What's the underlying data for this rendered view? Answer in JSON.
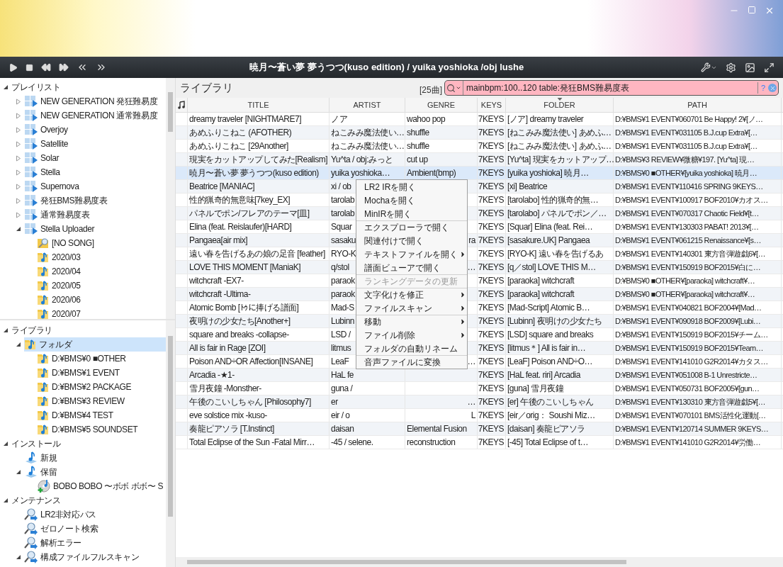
{
  "window": {
    "now_playing": "暁月〜蒼い夢 夢うつつ(kuso edition) / yuika yoshioka /obj lushe"
  },
  "sidebar": {
    "top_pane": [
      {
        "label": "プレイリスト",
        "expanded": true,
        "selected": false,
        "children": [
          {
            "label": "NEW GENERATION 発狂難易度",
            "kind": "playlist",
            "expanded": false,
            "selected": false
          },
          {
            "label": "NEW GENERATION 通常難易度",
            "kind": "playlist",
            "expanded": false,
            "selected": false
          },
          {
            "label": "Overjoy",
            "kind": "playlist",
            "expanded": false,
            "selected": false
          },
          {
            "label": "Satellite",
            "kind": "playlist",
            "expanded": false,
            "selected": false
          },
          {
            "label": "Solar",
            "kind": "playlist",
            "expanded": false,
            "selected": false
          },
          {
            "label": "Stella",
            "kind": "playlist",
            "expanded": false,
            "selected": false
          },
          {
            "label": "Supernova",
            "kind": "playlist",
            "expanded": false,
            "selected": false
          },
          {
            "label": "発狂BMS難易度表",
            "kind": "playlist",
            "expanded": false,
            "selected": false
          },
          {
            "label": "通常難易度表",
            "kind": "playlist",
            "expanded": false,
            "selected": false
          },
          {
            "label": "Stella Uploader",
            "kind": "playlist",
            "expanded": true,
            "selected": false,
            "children": [
              {
                "label": "[NO SONG]",
                "kind": "search-folder",
                "selected": false
              },
              {
                "label": "2020/03",
                "kind": "folder",
                "selected": false
              },
              {
                "label": "2020/04",
                "kind": "folder",
                "selected": false
              },
              {
                "label": "2020/05",
                "kind": "folder",
                "selected": false
              },
              {
                "label": "2020/06",
                "kind": "folder",
                "selected": false
              },
              {
                "label": "2020/07",
                "kind": "folder",
                "selected": false
              }
            ]
          }
        ]
      }
    ],
    "bottom_pane": [
      {
        "label": "ライブラリ",
        "expanded": true,
        "selected": false,
        "children": [
          {
            "label": "フォルダ",
            "kind": "folder",
            "expanded": true,
            "selected": true,
            "children": [
              {
                "label": "D:¥BMS¥0 ■OTHER",
                "kind": "folder",
                "selected": false
              },
              {
                "label": "D:¥BMS¥1 EVENT",
                "kind": "folder",
                "selected": false
              },
              {
                "label": "D:¥BMS¥2 PACKAGE",
                "kind": "folder",
                "selected": false
              },
              {
                "label": "D:¥BMS¥3 REVIEW",
                "kind": "folder",
                "selected": false
              },
              {
                "label": "D:¥BMS¥4 TEST",
                "kind": "folder",
                "selected": false
              },
              {
                "label": "D:¥BMS¥5 SOUNDSET",
                "kind": "folder",
                "selected": false
              }
            ]
          }
        ]
      },
      {
        "label": "インストール",
        "expanded": true,
        "selected": false,
        "children": [
          {
            "label": "新規",
            "kind": "install",
            "selected": false
          },
          {
            "label": "保留",
            "kind": "install",
            "expanded": true,
            "selected": false,
            "children": [
              {
                "label": "BOBO BOBO 〜ボボ ボボ〜 S",
                "kind": "disc-add",
                "selected": false
              }
            ]
          }
        ]
      },
      {
        "label": "メンテナンス",
        "expanded": true,
        "selected": false,
        "children": [
          {
            "label": "LR2非対応パス",
            "kind": "search-arrow",
            "selected": false
          },
          {
            "label": "ゼロノート検索",
            "kind": "search-arrow",
            "selected": false
          },
          {
            "label": "解析エラー",
            "kind": "search-arrow",
            "selected": false
          },
          {
            "label": "構成ファイルフルスキャン",
            "kind": "search-arrow",
            "expanded": true,
            "selected": false
          }
        ]
      }
    ]
  },
  "library": {
    "title": "ライブラリ",
    "count": "[25曲]",
    "search": {
      "value": "mainbpm:100..120 table:発狂BMS難易度表",
      "help": "?"
    }
  },
  "table": {
    "columns": [
      {
        "label": "TITLE",
        "sorted": false
      },
      {
        "label": "ARTIST",
        "sorted": false
      },
      {
        "label": "GENRE",
        "sorted": false
      },
      {
        "label": "KEYS",
        "sorted": false
      },
      {
        "label": "FOLDER",
        "sorted": true
      },
      {
        "label": "PATH",
        "sorted": false
      }
    ],
    "rows": [
      {
        "title": "dreamy traveler [NIGHTMARE7]",
        "artist": "ノア",
        "genre": "wahoo pop",
        "keys": "7KEYS",
        "folder": "[ノア] dreamy traveler",
        "path": "D:¥BMS¥1 EVENT¥060701 Be Happy! 2¥[ノ…",
        "selected": false
      },
      {
        "title": "あめふりこねこ (AFOTHER)",
        "artist": "ねこみみ魔法使い…",
        "genre": "shuffle",
        "keys": "7KEYS",
        "folder": "[ねこみみ魔法使い] あめふ…",
        "path": "D:¥BMS¥1 EVENT¥031105 B.J.cup Extra¥[…",
        "selected": false
      },
      {
        "title": "あめふりこねこ [29Another]",
        "artist": "ねこみみ魔法使い…",
        "genre": "shuffle",
        "keys": "7KEYS",
        "folder": "[ねこみみ魔法使い] あめふ…",
        "path": "D:¥BMS¥1 EVENT¥031105 B.J.cup Extra¥[…",
        "selected": false
      },
      {
        "title": "現実をカットアップしてみた[Realism]",
        "artist": "Yu^ta / obj:みっと",
        "genre": "cut up",
        "keys": "7KEYS",
        "folder": "[Yu^ta] 現実をカットアップ…",
        "path": "D:¥BMS¥3 REVIEW¥微糖¥197. [Yu^ta] 現…",
        "selected": false
      },
      {
        "title": "暁月〜蒼い夢 夢うつつ(kuso edition)",
        "artist": "yuika yoshioka…",
        "genre": "Ambient(bmp)",
        "keys": "7KEYS",
        "folder": "[yuika yoshioka] 暁月…",
        "path": "D:¥BMS¥0 ■OTHER¥[yuika yoshioka] 暁月…",
        "selected": true
      },
      {
        "title": "Beatrice [MANIAC]",
        "artist": "xi / ob",
        "keys": "7KEYS",
        "folder": "[xi] Beatrice",
        "path": "D:¥BMS¥1 EVENT¥110416 SPRING 9KEYS…",
        "selected": false
      },
      {
        "title": "性的猟奇的無意味[7key_EX]",
        "artist": "tarolab",
        "keys": "7KEYS",
        "folder": "[tarolabo] 性的猟奇的無…",
        "path": "D:¥BMS¥1 EVENT¥100917 BOF2010¥カオス…",
        "selected": false
      },
      {
        "title": "パネルでポン/フレアのテーマ[皿]",
        "artist": "tarolab",
        "keys": "7KEYS",
        "folder": "[tarolabo] パネルでポン／…",
        "path": "D:¥BMS¥1 EVENT¥070317 Chaotic Field¥[t…",
        "selected": false
      },
      {
        "title": "Elina (feat. Reislaufer)[HARD]",
        "artist": "Squar",
        "keys": "7KEYS",
        "folder": "[Squar] Elina (feat. Rei…",
        "path": "D:¥BMS¥1 EVENT¥130303 PABAT! 2013¥[…",
        "selected": false
      },
      {
        "title": "Pangaea[air mix]",
        "artist": "sasaku",
        "genre": "ra",
        "keys": "7KEYS",
        "folder": "[sasakure.UK] Pangaea",
        "path": "D:¥BMS¥1 EVENT¥061215 Renaissance¥[s…",
        "selected": false,
        "covered": true
      },
      {
        "title": "遠い春を告げるあの娘の足音 [feather]",
        "artist": "RYO-K",
        "keys": "7KEYS",
        "folder": "[RYO-K] 遠い春を告げるあ",
        "path": "D:¥BMS¥1 EVENT¥140301 東方音弾遊戯6¥[…",
        "selected": false
      },
      {
        "title": "LOVE THIS MOMENT [ManiaK]",
        "artist": "q/stol",
        "genre": "…",
        "keys": "7KEYS",
        "folder": "[q／stol] LOVE THIS M…",
        "path": "D:¥BMS¥1 EVENT¥150919 BOF2015¥白に…",
        "selected": false,
        "covered": true
      },
      {
        "title": "witchcraft -EX7-",
        "artist": "paraok",
        "keys": "7KEYS",
        "folder": "[paraoka] witchcraft",
        "path": "D:¥BMS¥0 ■OTHER¥[paraoka] witchcraft¥…",
        "selected": false
      },
      {
        "title": "witchcraft -Ultima-",
        "artist": "paraok",
        "keys": "7KEYS",
        "folder": "[paraoka] witchcraft",
        "path": "D:¥BMS¥0 ■OTHER¥[paraoka] witchcraft¥…",
        "selected": false
      },
      {
        "title": "Atomic Bomb [ﾄｩに捧げる譜面]",
        "artist": "Mad-S",
        "keys": "7KEYS",
        "folder": "[Mad-Script] Atomic B…",
        "path": "D:¥BMS¥1 EVENT¥040821 BOF2004¥[Mad…",
        "selected": false
      },
      {
        "title": "夜明けの少女たち[Another+]",
        "artist": "Lubinn",
        "keys": "7KEYS",
        "folder": "[Lubinn] 夜明けの少女たち",
        "path": "D:¥BMS¥1 EVENT¥090918 BOF2009¥[Lubi…",
        "selected": false
      },
      {
        "title": "square and breaks -collapse-",
        "artist": "LSD /",
        "keys": "7KEYS",
        "folder": "[LSD] square and breaks",
        "path": "D:¥BMS¥1 EVENT¥150919 BOF2015¥チーム…",
        "selected": false
      },
      {
        "title": "All is fair in Rage [ZOI]",
        "artist": "litmus",
        "keys": "7KEYS",
        "folder": "[litmus＊] All is fair in…",
        "path": "D:¥BMS¥1 EVENT¥150919 BOF2015¥Team…",
        "selected": false
      },
      {
        "title": "Poison AND÷OR Affection[INSANE]",
        "artist": "LeaF",
        "genre": "…",
        "keys": "7KEYS",
        "folder": "[LeaF] Poison AND÷O…",
        "path": "D:¥BMS¥1 EVENT¥141010 G2R2014¥カタス…",
        "selected": false,
        "covered": true
      },
      {
        "title": "Arcadia -★1-",
        "artist": "HaL fe",
        "keys": "7KEYS",
        "folder": "[HaL feat. riri] Arcadia",
        "path": "D:¥BMS¥1 EVENT¥051008 B-1 Unrestricte…",
        "selected": false
      },
      {
        "title": "雪月夜鐘 -Monsther-",
        "artist": "guna /",
        "keys": "7KEYS",
        "folder": "[guna] 雪月夜鐘",
        "path": "D:¥BMS¥1 EVENT¥050731 BOF2005¥[gun…",
        "selected": false
      },
      {
        "title": "午後のこいしちゃん [Philosophy7]",
        "artist": "er",
        "genre": "…",
        "keys": "7KEYS",
        "folder": "[er] 午後のこいしちゃん",
        "path": "D:¥BMS¥1 EVENT¥130310 東方音弾遊戯5¥[…",
        "selected": false,
        "covered": true
      },
      {
        "title": "eve solstice mix -kuso-",
        "artist": "eir / o",
        "genre": "L",
        "keys": "7KEYS",
        "folder": "[eir／orig： Soushi Miz…",
        "path": "D:¥BMS¥1 EVENT¥070101 BMS活性化運動[…",
        "selected": false,
        "covered": true
      },
      {
        "title": "奏龍ピアソラ [T.Instinct]",
        "artist": "daisan",
        "genre": "Elemental Fusion",
        "keys": "7KEYS",
        "folder": "[daisan] 奏龍ピアソラ",
        "path": "D:¥BMS¥1 EVENT¥120714 SUMMER 9KEYS…",
        "selected": false
      },
      {
        "title": "Total Eclipse of the Sun -Fatal Mirr…",
        "artist": "-45 / selene.",
        "genre": "reconstruction",
        "keys": "7KEYS",
        "folder": "[-45] Total Eclipse of t…",
        "path": "D:¥BMS¥1 EVENT¥141010 G2R2014¥労働…",
        "selected": false
      }
    ]
  },
  "context_menu": [
    {
      "kind": "item",
      "label": "LR2 IRを開く",
      "submenu": false,
      "disabled": false
    },
    {
      "kind": "item",
      "label": "Mochaを開く",
      "submenu": false,
      "disabled": false
    },
    {
      "kind": "item",
      "label": "MinIRを開く",
      "submenu": false,
      "disabled": false
    },
    {
      "kind": "separator"
    },
    {
      "kind": "item",
      "label": "エクスプローラで開く",
      "submenu": false,
      "disabled": false
    },
    {
      "kind": "item",
      "label": "関連付けで開く",
      "submenu": false,
      "disabled": false
    },
    {
      "kind": "item",
      "label": "テキストファイルを開く",
      "submenu": true,
      "disabled": false
    },
    {
      "kind": "item",
      "label": "譜面ビューアで開く",
      "submenu": false,
      "disabled": false
    },
    {
      "kind": "separator"
    },
    {
      "kind": "item",
      "label": "ランキングデータの更新",
      "submenu": false,
      "disabled": true
    },
    {
      "kind": "separator"
    },
    {
      "kind": "item",
      "label": "文字化けを修正",
      "submenu": true,
      "disabled": false
    },
    {
      "kind": "item",
      "label": "ファイルスキャン",
      "submenu": true,
      "disabled": false
    },
    {
      "kind": "separator"
    },
    {
      "kind": "item",
      "label": "移動",
      "submenu": true,
      "disabled": false
    },
    {
      "kind": "item",
      "label": "ファイル削除",
      "submenu": true,
      "disabled": false
    },
    {
      "kind": "item",
      "label": "フォルダの自動リネーム",
      "submenu": false,
      "disabled": false
    },
    {
      "kind": "separator"
    },
    {
      "kind": "item",
      "label": "音声ファイルに変換",
      "submenu": false,
      "disabled": false
    }
  ]
}
